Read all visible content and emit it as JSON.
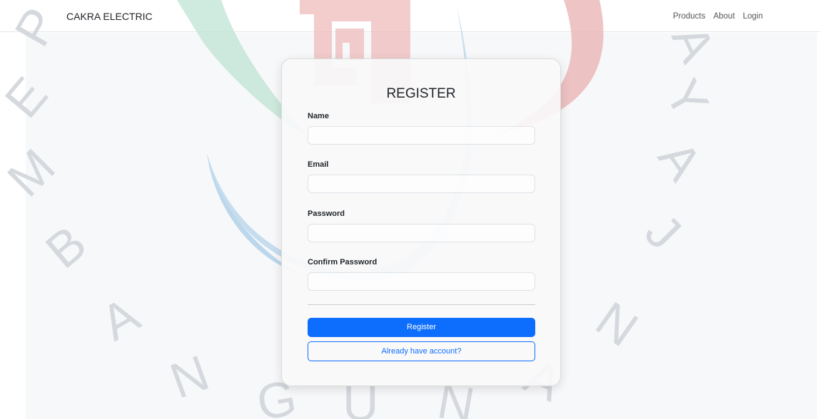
{
  "navbar": {
    "brand": "CAKRA ELECTRIC",
    "links": [
      "Products",
      "About",
      "Login"
    ]
  },
  "form": {
    "title": "REGISTER",
    "fields": [
      {
        "label": "Name",
        "value": "",
        "placeholder": ""
      },
      {
        "label": "Email",
        "value": "",
        "placeholder": ""
      },
      {
        "label": "Password",
        "value": "",
        "placeholder": ""
      },
      {
        "label": "Confirm Password",
        "value": "",
        "placeholder": ""
      }
    ],
    "submit_label": "Register",
    "login_link_label": "Already have account?"
  },
  "watermark": {
    "letters": [
      "P",
      "E",
      "M",
      "B",
      "A",
      "N",
      "G",
      "U",
      "N",
      "A",
      "N",
      "J",
      "A",
      "Y",
      "A"
    ],
    "colors": {
      "red": "#e8a3a3",
      "green": "#bfe3d3",
      "blue": "#b6d4ea"
    }
  },
  "colors": {
    "primary": "#0d6efd",
    "background": "#f7f8fa"
  }
}
